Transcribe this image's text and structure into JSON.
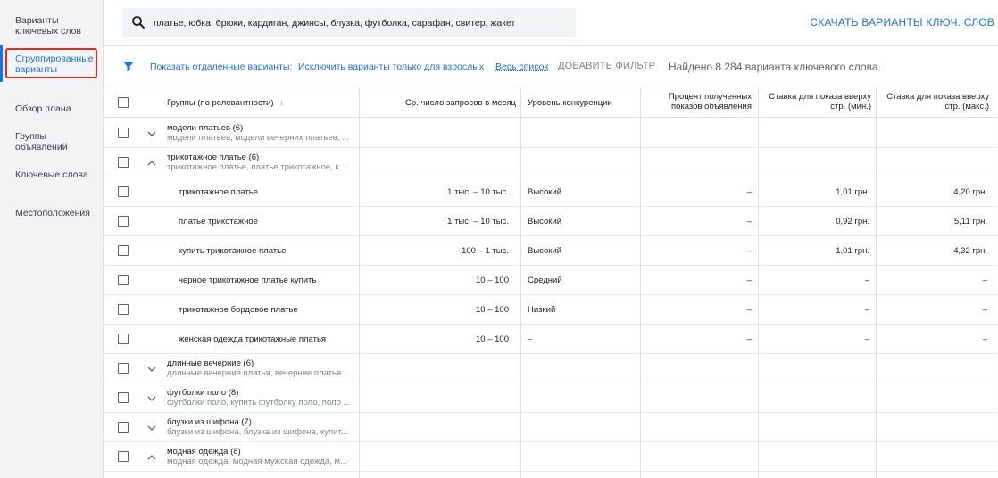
{
  "sidebar": {
    "items": [
      {
        "label": "Варианты ключевых слов"
      },
      {
        "label": "Сгруппированные варианты"
      },
      {
        "label": "Обзор плана"
      },
      {
        "label": "Группы объявлений"
      },
      {
        "label": "Ключевые слова"
      },
      {
        "label": "Местоположения"
      }
    ]
  },
  "search": {
    "value": "платье, юбка, брюки, кардиган, джинсы, блузка, футболка, сарафан, свитер, жакет",
    "icon": "search-icon"
  },
  "download_label": "СКАЧАТЬ ВАРИАНТЫ КЛЮЧ. СЛОВ",
  "filters": {
    "show_distant": "Показать отдаленные варианты;",
    "exclude_adult": "Исключить варианты только для взрослых",
    "all_list": "Весь список",
    "add_filter": "ДОБАВИТЬ ФИЛЬТР",
    "found": "Найдено 8 284 варианта ключевого слова."
  },
  "table": {
    "headers": {
      "group": "Группы (по релевантности)",
      "avg": "Ср. число запросов в месяц",
      "competition": "Уровень конкуренции",
      "impr_share": "Процент полученных показов объявления",
      "bid_low": "Ставка для показа вверху стр. (мин.)",
      "bid_high": "Ставка для показа вверху стр. (макс.)"
    },
    "rows": [
      {
        "type": "group",
        "title": "модели платьев (6)",
        "sub": "модели платьев, модели вечерних платьев, ...",
        "expanded": false
      },
      {
        "type": "group",
        "title": "трикотажное платье (6)",
        "sub": "трикотажное платье, платье трикотажное, к...",
        "expanded": true
      },
      {
        "type": "kw",
        "kw": "трикотажное платье",
        "avg": "1 тыс. – 10 тыс.",
        "comp": "Высокий",
        "share": "–",
        "low": "1,01 грн.",
        "high": "4,20 грн."
      },
      {
        "type": "kw",
        "kw": "платье трикотажное",
        "avg": "1 тыс. – 10 тыс.",
        "comp": "Высокий",
        "share": "–",
        "low": "0,92 грн.",
        "high": "5,11 грн."
      },
      {
        "type": "kw",
        "kw": "купить трикотажное платье",
        "avg": "100 – 1 тыс.",
        "comp": "Высокий",
        "share": "–",
        "low": "1,01 грн.",
        "high": "4,32 грн."
      },
      {
        "type": "kw",
        "kw": "черное трикотажное платье купить",
        "avg": "10 – 100",
        "comp": "Средний",
        "share": "–",
        "low": "–",
        "high": "–"
      },
      {
        "type": "kw",
        "kw": "трикотажное бордовое платье",
        "avg": "10 – 100",
        "comp": "Низкий",
        "share": "–",
        "low": "–",
        "high": "–"
      },
      {
        "type": "kw",
        "kw": "женская одежда трикотажные платья",
        "avg": "10 – 100",
        "comp": "–",
        "share": "–",
        "low": "–",
        "high": "–"
      },
      {
        "type": "group",
        "title": "длинные вечерние (6)",
        "sub": "длинные вечерние платья, вечерние платья ...",
        "expanded": false
      },
      {
        "type": "group",
        "title": "футболки поло (8)",
        "sub": "футболки поло, купить футболку поло, поло ...",
        "expanded": false
      },
      {
        "type": "group",
        "title": "блузки из шифона (7)",
        "sub": "блузки из шифона, блузка из шифона, купит...",
        "expanded": false
      },
      {
        "type": "group",
        "title": "модная одежда (8)",
        "sub": "модная одежда, модная мужская одежда, м...",
        "expanded": true
      }
    ]
  }
}
